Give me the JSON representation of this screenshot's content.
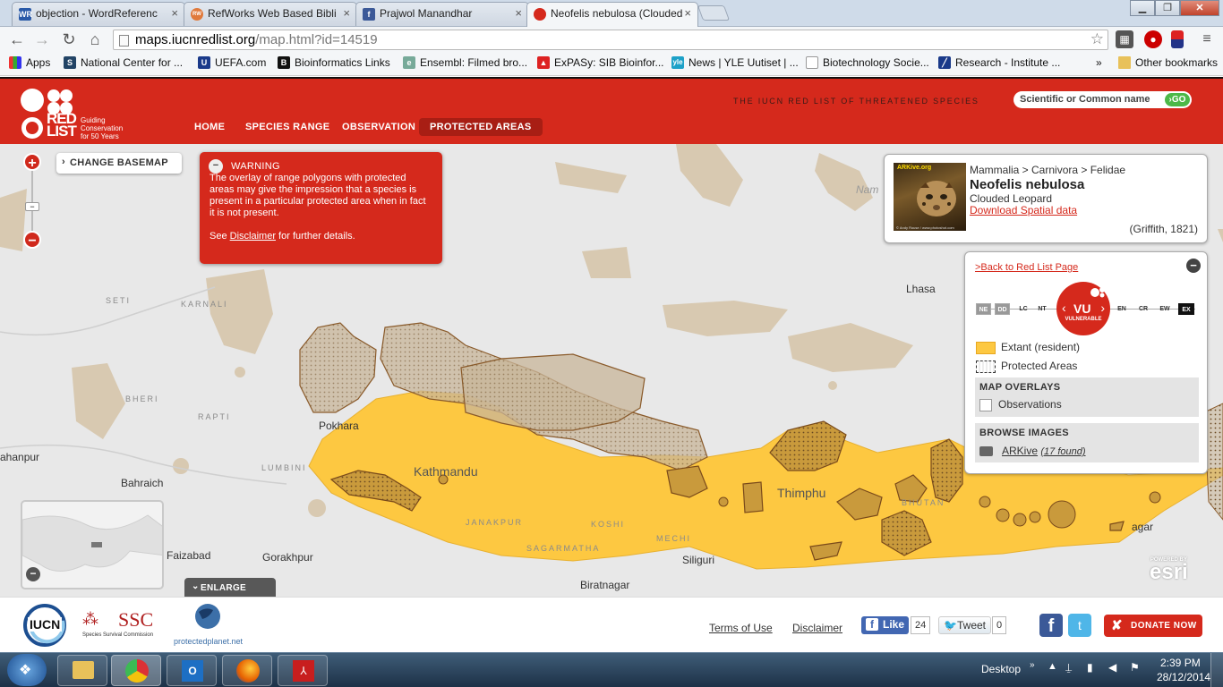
{
  "browser": {
    "tabs": [
      {
        "label": "objection - WordReferenc",
        "favicon": "WR"
      },
      {
        "label": "RefWorks Web Based Bibli",
        "favicon": "RW"
      },
      {
        "label": "Prajwol Manandhar",
        "favicon": "f"
      },
      {
        "label": "Neofelis nebulosa (Clouded",
        "favicon": "RL",
        "active": true
      }
    ],
    "url": {
      "domain": "maps.iucnredlist.org",
      "path": "/map.html?id=14519"
    },
    "bookmarks": [
      {
        "label": "Apps"
      },
      {
        "label": "National Center for ..."
      },
      {
        "label": "UEFA.com"
      },
      {
        "label": "Bioinformatics Links"
      },
      {
        "label": "Ensembl: Filmed bro..."
      },
      {
        "label": "ExPASy: SIB Bioinfor..."
      },
      {
        "label": "News | YLE Uutiset | ..."
      },
      {
        "label": "Biotechnology Socie..."
      },
      {
        "label": "Research - Institute ..."
      }
    ],
    "bookmarks_overflow": "»",
    "other_bookmarks": "Other bookmarks"
  },
  "site": {
    "logo_red": "RED",
    "logo_list": "LIST",
    "logo_tagline": [
      "Guiding",
      "Conservation",
      "for 50 Years"
    ],
    "nav": [
      "HOME",
      "SPECIES RANGE",
      "OBSERVATION",
      "PROTECTED AREAS"
    ],
    "tagline": "THE IUCN RED LIST OF THREATENED SPECIES",
    "search_placeholder": "Scientific or Common name",
    "search_go": "GO"
  },
  "map": {
    "change_basemap": "CHANGE BASEMAP",
    "warning": {
      "title": "WARNING",
      "body": "The overlay of range polygons with protected areas may give the impression that a species is present in a particular protected area when in fact it is not present.",
      "see": "See",
      "link": "Disclaimer",
      "after": "for further details."
    },
    "places": [
      "Lhasa",
      "Pokhara",
      "Kathmandu",
      "Thimphu",
      "Bahraich",
      "ahanpur",
      "Faizabad",
      "Gorakhpur",
      "Siliguri",
      "Biratnagar",
      "agar",
      "Nam"
    ],
    "regions": [
      "SETI",
      "KARNALI",
      "BHERI",
      "RAPTI",
      "LUMBINI",
      "SAGARMATHA",
      "JANAKPUR",
      "KOSHI",
      "MECHI",
      "BHUTAN"
    ],
    "enlarge": "ENLARGE",
    "esri_powered": "POWERED BY",
    "esri": "esri"
  },
  "species": {
    "classification": "Mammalia > Carnivora > Felidae",
    "scientific_name": "Neofelis nebulosa",
    "common_name": "Clouded Leopard",
    "download": "Download Spatial data",
    "authority": "(Griffith, 1821)",
    "photo_brand": "ARKive.org",
    "photo_credit": "© Andy Rouse / www.photoshot.com"
  },
  "legend": {
    "back": ">Back to Red List Page",
    "categories": [
      "NE",
      "DD",
      "LC",
      "NT",
      "VU",
      "EN",
      "CR",
      "EW",
      "EX"
    ],
    "selected_category": "VU",
    "selected_label": "VULNERABLE",
    "extant": "Extant (resident)",
    "protected": "Protected Areas",
    "overlays_title": "MAP OVERLAYS",
    "observations": "Observations",
    "images_title": "BROWSE IMAGES",
    "arkive": "ARKive",
    "arkive_count": "(17 found)",
    "colors": {
      "extant": "#fdc841",
      "red": "#d5291c"
    }
  },
  "footer": {
    "iucn": "IUCN",
    "ssc": "SSC",
    "ssc_sub": "Species Survival Commission",
    "pp": "protectedplanet.net",
    "terms": "Terms of Use",
    "disclaimer": "Disclaimer",
    "like": "Like",
    "like_count": "24",
    "tweet": "Tweet",
    "tweet_count": "0",
    "donate": "DONATE NOW"
  },
  "taskbar": {
    "desktop": "Desktop",
    "time": "2:39 PM",
    "date": "28/12/2014"
  }
}
